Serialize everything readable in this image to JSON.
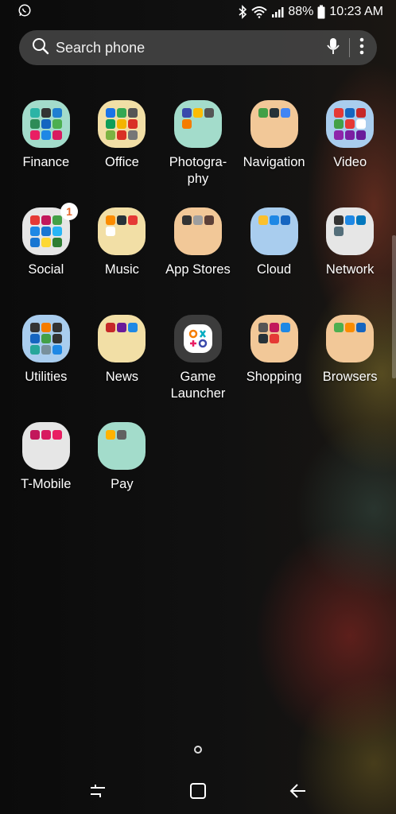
{
  "status_bar": {
    "notification_icon": "whatsapp-icon",
    "battery": "88%",
    "time": "10:23 AM",
    "icons": [
      "bluetooth-icon",
      "wifi-icon",
      "signal-icon",
      "battery-icon"
    ]
  },
  "search": {
    "placeholder": "Search phone"
  },
  "apps": [
    {
      "label": "Finance",
      "type": "folder",
      "color": "#a3dccb",
      "minis": [
        "#2bb4a6",
        "#333",
        "#1f7fd1",
        "#2e8b57",
        "#1565c0",
        "#4caf50",
        "#e91e63",
        "#1e88e5",
        "#d81b60"
      ]
    },
    {
      "label": "Office",
      "type": "folder",
      "color": "#f2dfa6",
      "minis": [
        "#1a73e8",
        "#34a853",
        "#555",
        "#0f9d58",
        "#f4b400",
        "#d93025",
        "#7cb342",
        "#d93025",
        "#777"
      ]
    },
    {
      "label": "Photogra-\nphy",
      "type": "folder",
      "color": "#a3dccb",
      "minis": [
        "#3949ab",
        "#fbbc05",
        "#555",
        "#f57c00"
      ]
    },
    {
      "label": "Navigation",
      "type": "folder",
      "color": "#f2c898",
      "minis": [
        "#43a047",
        "#263238",
        "#4285f4"
      ]
    },
    {
      "label": "Video",
      "type": "folder",
      "color": "#a9cdee",
      "minis": [
        "#e53935",
        "#1565c0",
        "#c62828",
        "#43a047",
        "#e53935",
        "#fff",
        "#8e24aa",
        "#7b1fa2",
        "#6a1b9a"
      ]
    },
    {
      "label": "Social",
      "type": "folder",
      "color": "#e6e6e6",
      "badge": "1",
      "minis": [
        "#e53935",
        "#c2185b",
        "#43a047",
        "#1e88e5",
        "#1976d2",
        "#29b6f6",
        "#1976d2",
        "#fdd835",
        "#2e7d32"
      ]
    },
    {
      "label": "Music",
      "type": "folder",
      "color": "#f2dfa6",
      "minis": [
        "#fb8c00",
        "#263238",
        "#e53935",
        "#fff"
      ]
    },
    {
      "label": "App Stores",
      "type": "folder",
      "color": "#f2c898",
      "minis": [
        "#333",
        "#9e9e9e",
        "#5d4037"
      ]
    },
    {
      "label": "Cloud",
      "type": "folder",
      "color": "#a9cdee",
      "minis": [
        "#fbc02d",
        "#1e88e5",
        "#1565c0"
      ]
    },
    {
      "label": "Network",
      "type": "folder",
      "color": "#e6e6e6",
      "minis": [
        "#333",
        "#1e88e5",
        "#0277bd",
        "#546e7a"
      ]
    },
    {
      "label": "Utilities",
      "type": "folder",
      "color": "#a9cdee",
      "minis": [
        "#333",
        "#f57c00",
        "#333",
        "#1565c0",
        "#43a047",
        "#333",
        "#26a69a",
        "#78909c",
        "#1e88e5"
      ]
    },
    {
      "label": "News",
      "type": "folder",
      "color": "#f2dfa6",
      "minis": [
        "#c62828",
        "#6a1b9a",
        "#1e88e5"
      ]
    },
    {
      "label": "Game\nLauncher",
      "type": "game"
    },
    {
      "label": "Shopping",
      "type": "folder",
      "color": "#f2c898",
      "minis": [
        "#555",
        "#c2185b",
        "#1e88e5",
        "#263238",
        "#e53935"
      ]
    },
    {
      "label": "Browsers",
      "type": "folder",
      "color": "#f2c898",
      "minis": [
        "#4caf50",
        "#fb8c00",
        "#1565c0"
      ]
    },
    {
      "label": "T-Mobile",
      "type": "folder",
      "color": "#e6e6e6",
      "minis": [
        "#c2185b",
        "#d81b60",
        "#e91e63"
      ]
    },
    {
      "label": "Pay",
      "type": "folder",
      "color": "#a3dccb",
      "minis": [
        "#ffb300",
        "#616161"
      ]
    }
  ],
  "nav": {
    "recents": "recents-icon",
    "home": "home-icon",
    "back": "back-icon"
  }
}
